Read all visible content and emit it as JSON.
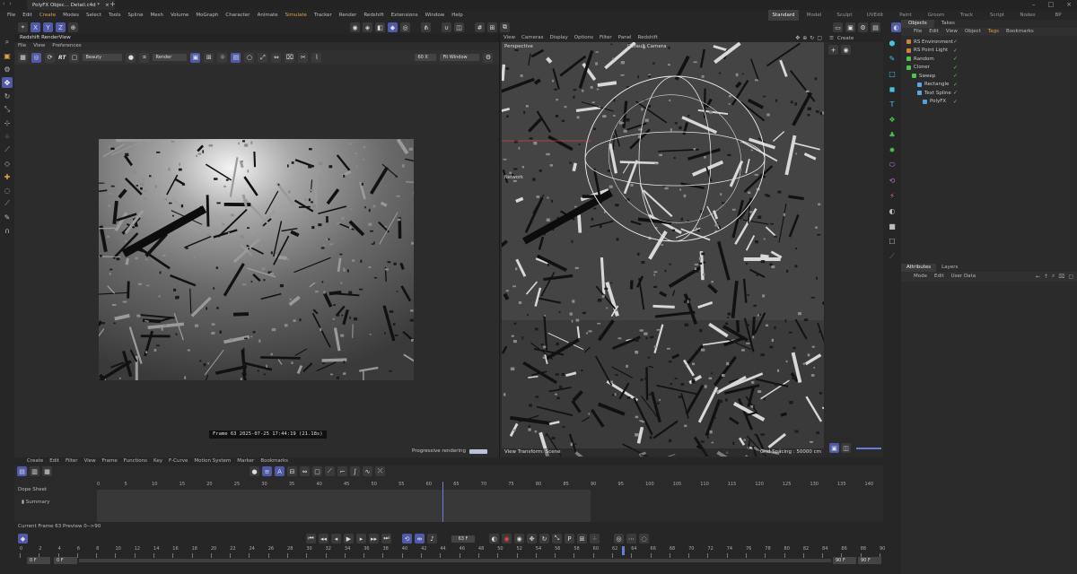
{
  "titlebar": {
    "doc_tab": "PolyFX Objec... Detail.c4d *",
    "plus": "+"
  },
  "menubar": {
    "items": [
      "File",
      "Edit",
      "Create",
      "Modes",
      "Select",
      "Tools",
      "Spline",
      "Mesh",
      "Volume",
      "MoGraph",
      "Character",
      "Animate",
      "Simulate",
      "Tracker",
      "Render",
      "Redshift",
      "Extensions",
      "Window",
      "Help"
    ],
    "layouts": [
      "Standard",
      "Model",
      "Sculpt",
      "UVEdit",
      "Paint",
      "Groom",
      "Track",
      "Script",
      "Nodes",
      "BP"
    ]
  },
  "toolrow": {
    "axes": [
      "X",
      "Y",
      "Z"
    ]
  },
  "renderview": {
    "title": "Redshift RenderView",
    "menus": [
      "File",
      "View",
      "Preferences"
    ],
    "aov": "Beauty",
    "rt": "RT",
    "render_mode": "Render",
    "zoom": "60 X",
    "fit": "Fit Window",
    "frame_info": "Frame  63  2025-07-25  17:44:19  (21.18s)",
    "progressive": "Progressive rendering"
  },
  "viewport": {
    "menus": [
      "View",
      "Cameras",
      "Display",
      "Options",
      "Filter",
      "Panel",
      "Redshift"
    ],
    "label": "Perspective",
    "camera": "Default Camera",
    "network": "Network",
    "footer_left": "View Transform: Scene",
    "footer_right": "Grid Spacing : 50000 cm"
  },
  "create_panel": {
    "label": "Create"
  },
  "objects": {
    "tabs": [
      "Objects",
      "Takes"
    ],
    "menus": [
      "File",
      "Edit",
      "View",
      "Object",
      "Tags",
      "Bookmarks"
    ],
    "items": [
      {
        "name": "RS Environment",
        "color": "#d87c3c",
        "indent": 0
      },
      {
        "name": "RS Point Light",
        "color": "#d87c3c",
        "indent": 0
      },
      {
        "name": "Random",
        "color": "#4fc24f",
        "indent": 0
      },
      {
        "name": "Cloner",
        "color": "#4fc24f",
        "indent": 0
      },
      {
        "name": "Sweep",
        "color": "#4fc24f",
        "indent": 1
      },
      {
        "name": "Rectangle",
        "color": "#5aa7e6",
        "indent": 2
      },
      {
        "name": "Text Spline",
        "color": "#5aa7e6",
        "indent": 2
      },
      {
        "name": "PolyFX",
        "color": "#4fa0e6",
        "indent": 3
      }
    ]
  },
  "attributes": {
    "tabs": [
      "Attributes",
      "Layers"
    ],
    "menus": [
      "Mode",
      "Edit",
      "User Data"
    ]
  },
  "timeline": {
    "menus": [
      "Create",
      "Edit",
      "Filter",
      "View",
      "Frame",
      "Functions",
      "Key",
      "F-Curve",
      "Motion System",
      "Marker",
      "Bookmarks"
    ],
    "dope_sheet": "Dope Sheet",
    "summary": "Summary",
    "ruler": [
      "0",
      "5",
      "10",
      "15",
      "20",
      "25",
      "30",
      "35",
      "40",
      "45",
      "50",
      "55",
      "60",
      "65",
      "70",
      "75",
      "80",
      "85",
      "90",
      "95",
      "100",
      "105",
      "110",
      "115",
      "120",
      "125",
      "130",
      "135",
      "140"
    ],
    "current": "Current Frame  63   Preview  0-->90"
  },
  "transport": {
    "frame_field": "63 F",
    "start": "0 F",
    "start2": "0 F",
    "end": "90 F",
    "end2": "90 F",
    "ruler": [
      "0",
      "2",
      "4",
      "6",
      "8",
      "10",
      "12",
      "14",
      "16",
      "18",
      "20",
      "22",
      "24",
      "26",
      "28",
      "30",
      "32",
      "34",
      "36",
      "38",
      "40",
      "42",
      "44",
      "46",
      "48",
      "50",
      "52",
      "54",
      "56",
      "58",
      "60",
      "62",
      "64",
      "66",
      "68",
      "70",
      "72",
      "74",
      "76",
      "78",
      "80",
      "82",
      "84",
      "86",
      "88",
      "90"
    ],
    "playhead": "63"
  },
  "colors": {
    "accent": "#4f5aa8",
    "orange": "#e0a04a",
    "green": "#4fc24f",
    "cyan": "#46c1e0"
  }
}
